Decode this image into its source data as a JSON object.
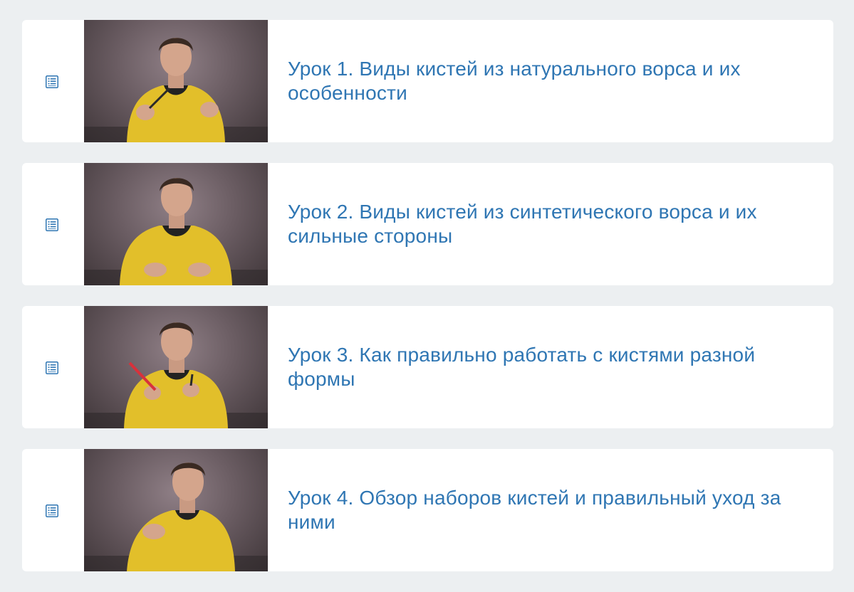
{
  "lessons": [
    {
      "title": "Урок 1. Виды кистей из натурального ворса и их особенности",
      "icon": "lesson-list-icon",
      "thumbnail": "presenter-video-thumbnail"
    },
    {
      "title": "Урок 2. Виды кистей из синтетического ворса и их сильные стороны",
      "icon": "lesson-list-icon",
      "thumbnail": "presenter-video-thumbnail"
    },
    {
      "title": "Урок 3. Как правильно работать с кистями разной формы",
      "icon": "lesson-list-icon",
      "thumbnail": "presenter-video-thumbnail"
    },
    {
      "title": "Урок 4. Обзор наборов кистей и правильный уход за ними",
      "icon": "lesson-list-icon",
      "thumbnail": "presenter-video-thumbnail"
    }
  ],
  "colors": {
    "page_background": "#eceff1",
    "card_background": "#ffffff",
    "title_link": "#2f76b3",
    "icon": "#2f76b3",
    "hoodie": "#e2bf2a"
  }
}
